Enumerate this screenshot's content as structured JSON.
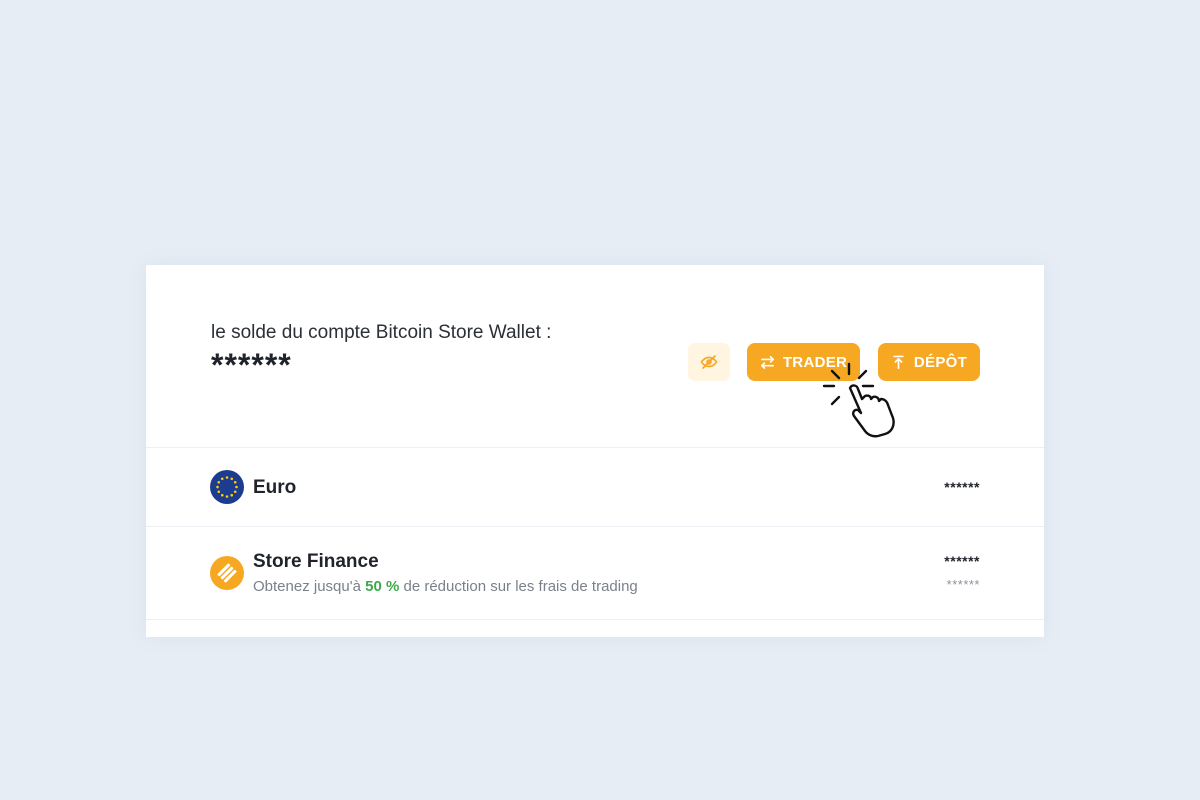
{
  "balance": {
    "label": "le solde du compte Bitcoin Store Wallet :",
    "value": "******"
  },
  "actions": {
    "visibility_icon": "eye-slash-icon",
    "trader_label": "TRADER",
    "trader_icon": "swap-arrows-icon",
    "depot_label": "DÉPÔT",
    "depot_icon": "upload-arrow-icon"
  },
  "assets": [
    {
      "name": "Euro",
      "icon": "eu-flag-icon",
      "amount": "******"
    },
    {
      "name": "Store Finance",
      "icon": "store-finance-logo-icon",
      "promo_prefix": "Obtenez jusqu'à ",
      "promo_percent": "50 %",
      "promo_suffix": " de réduction sur les frais de trading",
      "amount": "******",
      "amount_secondary": "******"
    }
  ],
  "colors": {
    "background": "#e6edf5",
    "accent": "#f7a823",
    "accent_light": "#fff5e1",
    "promo_green": "#3da94c",
    "eu_blue": "#1b3c8f",
    "eu_star": "#ffcc00"
  }
}
